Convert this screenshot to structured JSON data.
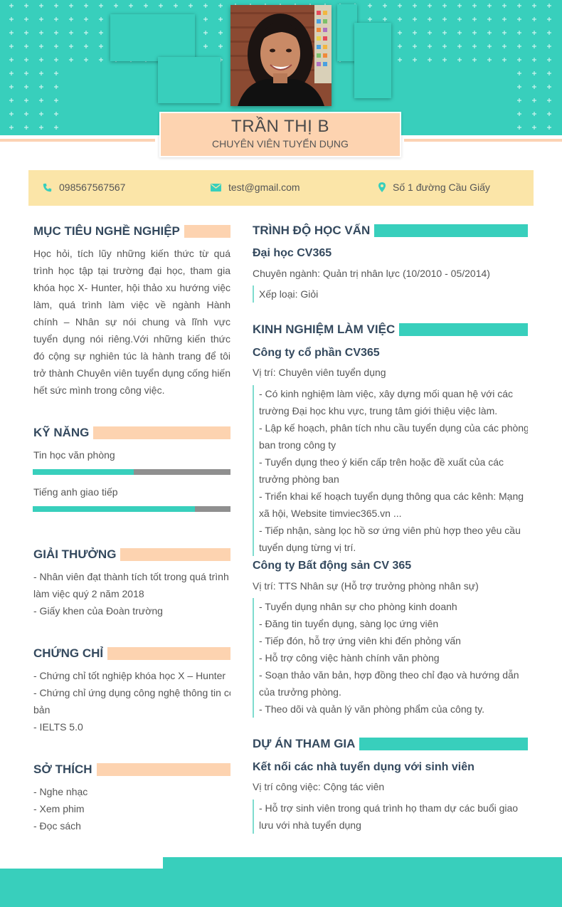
{
  "colors": {
    "teal": "#38cfbc",
    "peach": "#fdd3b0",
    "yellow": "#fbe5a8",
    "heading": "#34495e"
  },
  "profile": {
    "name": "TRẦN THỊ B",
    "title": "CHUYÊN VIÊN TUYỂN DỤNG"
  },
  "contact": {
    "phone_icon": "phone-icon",
    "phone": "098567567567",
    "email_icon": "mail-icon",
    "email": "test@gmail.com",
    "address_icon": "map-pin-icon",
    "address": "Số 1 đường Cầu Giấy"
  },
  "objective": {
    "heading": "MỤC TIÊU NGHỀ NGHIỆP",
    "text": "Học hỏi, tích lũy những kiến thức từ quá trình học tập tại trường đại học, tham gia khóa học X- Hunter, hội thảo xu hướng việc làm, quá trình làm việc về ngành Hành chính – Nhân sự nói chung và lĩnh vực tuyển dụng nói riêng.Với những kiến thức đó cộng sự nghiên túc là hành trang để tôi trở thành Chuyên viên tuyển dụng cống hiến hết sức mình trong công việc."
  },
  "skills": {
    "heading": "KỸ NĂNG",
    "items": [
      {
        "label": "Tin học văn phòng",
        "level": 0.51
      },
      {
        "label": "Tiếng anh giao tiếp",
        "level": 0.82
      }
    ]
  },
  "awards": {
    "heading": "GIẢI THƯỞNG",
    "lines": [
      "- Nhân viên đạt thành tích tốt trong quá trình",
      "làm việc quý 2 năm 2018",
      "- Giấy khen của Đoàn trường"
    ]
  },
  "certificates": {
    "heading": "CHỨNG CHỈ",
    "lines": [
      "- Chứng chỉ tốt nghiệp khóa học X – Hunter",
      "- Chứng chỉ ứng dụng công nghệ thông tin cơ",
      "bản",
      "- IELTS 5.0"
    ]
  },
  "hobbies": {
    "heading": "SỞ THÍCH",
    "lines": [
      "- Nghe nhạc",
      "- Xem phim",
      "- Đọc sách"
    ]
  },
  "education": {
    "heading": "TRÌNH ĐỘ HỌC VẤN",
    "school": "Đại học CV365",
    "major": "Chuyên ngành: Quản trị nhân lực (10/2010 - 05/2014)",
    "grade": "Xếp loại: Giỏi"
  },
  "experience": {
    "heading": "KINH NGHIỆM LÀM VIỆC",
    "jobs": [
      {
        "company": "Công ty cổ phần CV365",
        "position": "Vị trí: Chuyên viên tuyển dụng",
        "lines": [
          "- Có kinh nghiệm làm việc, xây dựng mối quan hệ với các",
          "trường Đại học khu vực, trung tâm giới thiệu việc làm.",
          "- Lập kế hoạch, phân tích nhu cầu tuyển dụng của các phòng",
          "ban trong công ty",
          "- Tuyển dụng theo ý kiến cấp trên hoặc đề xuất của các",
          "trưởng phòng ban",
          "- Triển khai kế hoạch tuyển dụng thông qua các kênh: Mạng",
          "xã hội, Website timviec365.vn ...",
          "- Tiếp nhận, sàng lọc hồ sơ ứng viên phù hợp theo yêu cầu",
          "tuyển dụng từng vị trí."
        ]
      },
      {
        "company": "Công ty Bất động sản CV 365",
        "position": "Vị trí: TTS Nhân sự (Hỗ trợ trưởng phòng nhân sự)",
        "lines": [
          "- Tuyển dụng nhân sự cho phòng kinh doanh",
          "- Đăng tin tuyển dụng, sàng lọc ứng viên",
          "- Tiếp đón, hỗ trợ ứng viên khi đến phỏng vấn",
          "- Hỗ trợ công việc hành chính văn phòng",
          "- Soạn thảo văn bản, hợp đồng theo chỉ đạo và hướng dẫn",
          "của trưởng phòng.",
          "- Theo dõi và quản lý văn phòng phẩm của công ty."
        ]
      }
    ]
  },
  "projects": {
    "heading": "DỰ ÁN THAM GIA",
    "name": "Kết nối các nhà tuyển dụng với sinh viên",
    "position": "Vị trí công việc: Cộng tác viên",
    "lines": [
      "- Hỗ trợ sinh viên trong quá trình họ tham dự các buổi giao",
      "lưu với nhà tuyển dụng"
    ]
  }
}
